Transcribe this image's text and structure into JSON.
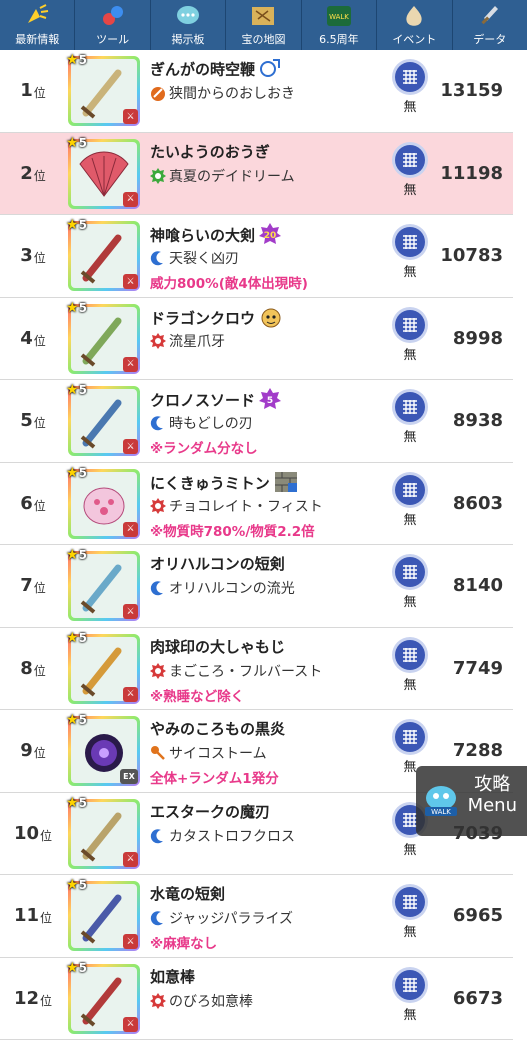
{
  "nav": [
    {
      "label": "最新情報",
      "icon": "news-icon"
    },
    {
      "label": "ツール",
      "icon": "tool-icon"
    },
    {
      "label": "掲示板",
      "icon": "board-icon"
    },
    {
      "label": "宝の地図",
      "icon": "treasure-map-icon"
    },
    {
      "label": "6.5周年",
      "icon": "anniversary-icon"
    },
    {
      "label": "イベント",
      "icon": "event-icon"
    },
    {
      "label": "データ",
      "icon": "data-icon"
    }
  ],
  "rank_suffix": "位",
  "element_label": "無",
  "rows": [
    {
      "rank": "1",
      "name": "ぎんがの時空鞭",
      "skill": "狭間からのおしおき",
      "skill_icon": "slash-orange",
      "note": "",
      "score": "13159",
      "badge": "blue-swirl",
      "highlight": false,
      "weapon": "whip"
    },
    {
      "rank": "2",
      "name": "たいようのおうぎ",
      "skill": "真夏のデイドリーム",
      "skill_icon": "gear-green",
      "note": "",
      "score": "11198",
      "badge": "",
      "highlight": true,
      "weapon": "fan"
    },
    {
      "rank": "3",
      "name": "神喰らいの大剣",
      "skill": "天裂く凶刃",
      "skill_icon": "crescent-blue",
      "note": "威力800%(敵4体出現時)",
      "score": "10783",
      "badge": "purple-20",
      "highlight": false,
      "weapon": "greatsword"
    },
    {
      "rank": "4",
      "name": "ドラゴンクロウ",
      "skill": "流星爪牙",
      "skill_icon": "gear-red",
      "note": "",
      "score": "8998",
      "badge": "monster-face",
      "highlight": false,
      "weapon": "claw"
    },
    {
      "rank": "5",
      "name": "クロノスソード",
      "skill": "時もどしの刃",
      "skill_icon": "crescent-blue",
      "note": "※ランダム分なし",
      "score": "8938",
      "badge": "purple-5",
      "highlight": false,
      "weapon": "sword"
    },
    {
      "rank": "6",
      "name": "にくきゅうミトン",
      "skill": "チョコレイト・フィスト",
      "skill_icon": "gear-red",
      "note": "※物質時780%/物質2.2倍",
      "score": "8603",
      "badge": "brick",
      "highlight": false,
      "weapon": "mitten"
    },
    {
      "rank": "7",
      "name": "オリハルコンの短剣",
      "skill": "オリハルコンの流光",
      "skill_icon": "crescent-blue",
      "note": "",
      "score": "8140",
      "badge": "",
      "highlight": false,
      "weapon": "dagger"
    },
    {
      "rank": "8",
      "name": "肉球印の大しゃもじ",
      "skill": "まごころ・フルバースト",
      "skill_icon": "gear-red",
      "note": "※熟睡など除く",
      "score": "7749",
      "badge": "",
      "highlight": false,
      "weapon": "ladle"
    },
    {
      "rank": "9",
      "name": "やみのころもの黒炎",
      "skill": "サイコストーム",
      "skill_icon": "key-orange",
      "note": "全体+ランダム1発分",
      "score": "7288",
      "badge": "",
      "highlight": false,
      "weapon": "orb",
      "ex": true
    },
    {
      "rank": "10",
      "name": "エスタークの魔刃",
      "skill": "カタストロフクロス",
      "skill_icon": "crescent-blue",
      "note": "",
      "score": "7039",
      "badge": "",
      "highlight": false,
      "weapon": "blade"
    },
    {
      "rank": "11",
      "name": "水竜の短剣",
      "skill": "ジャッジパラライズ",
      "skill_icon": "crescent-blue",
      "note": "※麻痺なし",
      "score": "6965",
      "badge": "",
      "highlight": false,
      "weapon": "waterdagger"
    },
    {
      "rank": "12",
      "name": "如意棒",
      "skill": "のびろ如意棒",
      "skill_icon": "gear-red",
      "note": "",
      "score": "6673",
      "badge": "",
      "highlight": false,
      "weapon": "staff"
    }
  ],
  "fab": {
    "line1": "攻略",
    "line2": "Menu",
    "logo_text": "WALK"
  },
  "colors": {
    "nav_bg": "#2f5f92",
    "highlight_row": "#fbd7dc",
    "note_pink": "#e8398a",
    "element_blue": "#3b57b5"
  }
}
